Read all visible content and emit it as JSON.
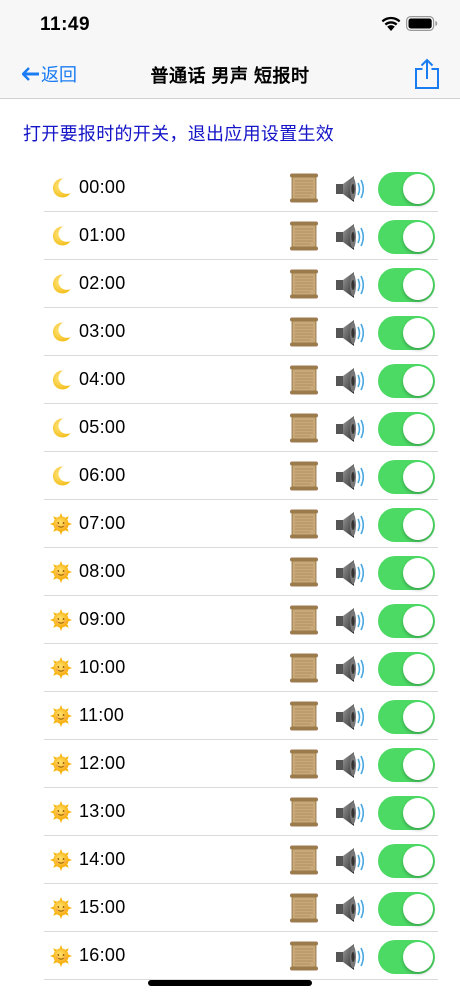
{
  "status_bar": {
    "time": "11:49"
  },
  "nav": {
    "back_label": "返回",
    "title": "普通话 男声 短报时"
  },
  "instruction": "打开要报时的开关，退出应用设置生效",
  "colors": {
    "accent": "#1a7cf3",
    "instruction_text": "#1515c8",
    "toggle_on": "#4cd964"
  },
  "rows": [
    {
      "time": "00:00",
      "icon": "crescent-moon-icon",
      "enabled": true
    },
    {
      "time": "01:00",
      "icon": "crescent-moon-icon",
      "enabled": true
    },
    {
      "time": "02:00",
      "icon": "crescent-moon-icon",
      "enabled": true
    },
    {
      "time": "03:00",
      "icon": "crescent-moon-icon",
      "enabled": true
    },
    {
      "time": "04:00",
      "icon": "crescent-moon-icon",
      "enabled": true
    },
    {
      "time": "05:00",
      "icon": "crescent-moon-icon",
      "enabled": true
    },
    {
      "time": "06:00",
      "icon": "crescent-moon-icon",
      "enabled": true
    },
    {
      "time": "07:00",
      "icon": "sun-face-icon",
      "enabled": true
    },
    {
      "time": "08:00",
      "icon": "sun-face-icon",
      "enabled": true
    },
    {
      "time": "09:00",
      "icon": "sun-face-icon",
      "enabled": true
    },
    {
      "time": "10:00",
      "icon": "sun-face-icon",
      "enabled": true
    },
    {
      "time": "11:00",
      "icon": "sun-face-icon",
      "enabled": true
    },
    {
      "time": "12:00",
      "icon": "sun-face-icon",
      "enabled": true
    },
    {
      "time": "13:00",
      "icon": "sun-face-icon",
      "enabled": true
    },
    {
      "time": "14:00",
      "icon": "sun-face-icon",
      "enabled": true
    },
    {
      "time": "15:00",
      "icon": "sun-face-icon",
      "enabled": true
    },
    {
      "time": "16:00",
      "icon": "sun-face-icon",
      "enabled": true
    }
  ]
}
